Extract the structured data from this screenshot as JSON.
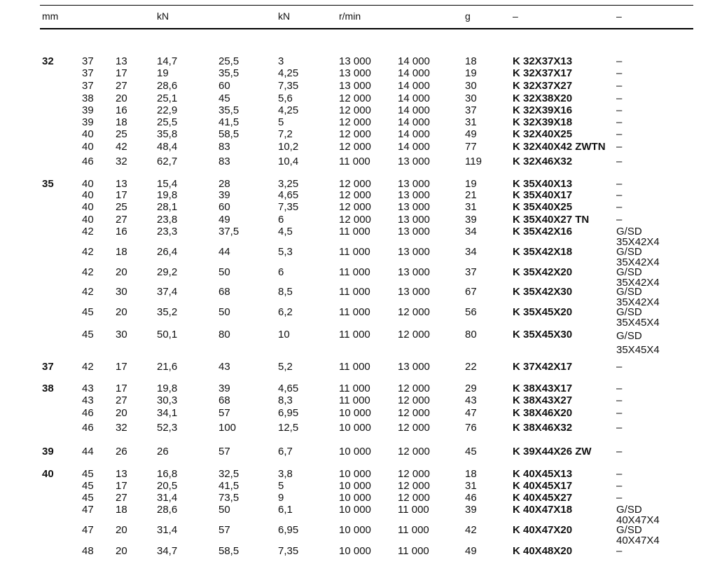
{
  "units": {
    "mm": "mm",
    "kn_1": "kN",
    "kn_2": "kN",
    "speed": "r/min",
    "mass": "g",
    "designation": "–",
    "accessory": "–"
  },
  "groups": [
    {
      "d": "32",
      "rows": [
        [
          "37",
          "13",
          "14,7",
          "25,5",
          "3",
          "13 000",
          "14 000",
          "18",
          "K 32X37X13",
          "–"
        ],
        [
          "37",
          "17",
          "19",
          "35,5",
          "4,25",
          "13 000",
          "14 000",
          "19",
          "K 32X37X17",
          "–"
        ],
        [
          "37",
          "27",
          "28,6",
          "60",
          "7,35",
          "13 000",
          "14 000",
          "30",
          "K 32X37X27",
          "–"
        ],
        [
          "38",
          "20",
          "25,1",
          "45",
          "5,6",
          "12 000",
          "14 000",
          "30",
          "K 32X38X20",
          "–"
        ],
        [
          "39",
          "16",
          "22,9",
          "35,5",
          "4,25",
          "12 000",
          "14 000",
          "37",
          "K 32X39X16",
          "–"
        ],
        [
          "39",
          "18",
          "25,5",
          "41,5",
          "5",
          "12 000",
          "14 000",
          "31",
          "K 32X39X18",
          "–"
        ],
        [
          "40",
          "25",
          "35,8",
          "58,5",
          "7,2",
          "12 000",
          "14 000",
          "49",
          "K 32X40X25",
          "–"
        ],
        [
          "40",
          "42",
          "48,4",
          "83",
          "10,2",
          "12 000",
          "14 000",
          "77",
          "K 32X40X42 ZWTN",
          "–"
        ],
        [
          "46",
          "32",
          "62,7",
          "83",
          "10,4",
          "11 000",
          "13 000",
          "119",
          "K 32X46X32",
          "–"
        ]
      ]
    },
    {
      "d": "35",
      "rows": [
        [
          "40",
          "13",
          "15,4",
          "28",
          "3,25",
          "12 000",
          "13 000",
          "19",
          "K 35X40X13",
          "–"
        ],
        [
          "40",
          "17",
          "19,8",
          "39",
          "4,65",
          "12 000",
          "13 000",
          "21",
          "K 35X40X17",
          "–"
        ],
        [
          "40",
          "25",
          "28,1",
          "60",
          "7,35",
          "12 000",
          "13 000",
          "31",
          "K 35X40X25",
          "–"
        ],
        [
          "40",
          "27",
          "23,8",
          "49",
          "6",
          "12 000",
          "13 000",
          "39",
          "K 35X40X27 TN",
          "–"
        ],
        [
          "42",
          "16",
          "23,3",
          "37,5",
          "4,5",
          "11 000",
          "13 000",
          "34",
          "K 35X42X16",
          "G/SD 35X42X4"
        ],
        [
          "42",
          "18",
          "26,4",
          "44",
          "5,3",
          "11 000",
          "13 000",
          "34",
          "K 35X42X18",
          "G/SD 35X42X4"
        ],
        [
          "42",
          "20",
          "29,2",
          "50",
          "6",
          "11 000",
          "13 000",
          "37",
          "K 35X42X20",
          "G/SD 35X42X4"
        ],
        [
          "42",
          "30",
          "37,4",
          "68",
          "8,5",
          "11 000",
          "13 000",
          "67",
          "K 35X42X30",
          "G/SD 35X42X4"
        ],
        [
          "45",
          "20",
          "35,2",
          "50",
          "6,2",
          "11 000",
          "12 000",
          "56",
          "K 35X45X20",
          "G/SD 35X45X4"
        ],
        [
          "45",
          "30",
          "50,1",
          "80",
          "10",
          "11 000",
          "12 000",
          "80",
          "K 35X45X30",
          "G/SD 35X45X4"
        ]
      ]
    },
    {
      "d": "37",
      "rows": [
        [
          "42",
          "17",
          "21,6",
          "43",
          "5,2",
          "11 000",
          "13 000",
          "22",
          "K 37X42X17",
          "–"
        ]
      ]
    },
    {
      "d": "38",
      "rows": [
        [
          "43",
          "17",
          "19,8",
          "39",
          "4,65",
          "11 000",
          "12 000",
          "29",
          "K 38X43X17",
          "–"
        ],
        [
          "43",
          "27",
          "30,3",
          "68",
          "8,3",
          "11 000",
          "12 000",
          "43",
          "K 38X43X27",
          "–"
        ],
        [
          "46",
          "20",
          "34,1",
          "57",
          "6,95",
          "10 000",
          "12 000",
          "47",
          "K 38X46X20",
          "–"
        ],
        [
          "46",
          "32",
          "52,3",
          "100",
          "12,5",
          "10 000",
          "12 000",
          "76",
          "K 38X46X32",
          "–"
        ]
      ]
    },
    {
      "d": "39",
      "rows": [
        [
          "44",
          "26",
          "26",
          "57",
          "6,7",
          "10 000",
          "12 000",
          "45",
          "K 39X44X26 ZW",
          "–"
        ]
      ]
    },
    {
      "d": "40",
      "rows": [
        [
          "45",
          "13",
          "16,8",
          "32,5",
          "3,8",
          "10 000",
          "12 000",
          "18",
          "K 40X45X13",
          "–"
        ],
        [
          "45",
          "17",
          "20,5",
          "41,5",
          "5",
          "10 000",
          "12 000",
          "31",
          "K 40X45X17",
          "–"
        ],
        [
          "45",
          "27",
          "31,4",
          "73,5",
          "9",
          "10 000",
          "12 000",
          "46",
          "K 40X45X27",
          "–"
        ],
        [
          "47",
          "18",
          "28,6",
          "50",
          "6,1",
          "10 000",
          "11 000",
          "39",
          "K 40X47X18",
          "G/SD 40X47X4"
        ],
        [
          "47",
          "20",
          "31,4",
          "57",
          "6,95",
          "10 000",
          "11 000",
          "42",
          "K 40X47X20",
          "G/SD 40X47X4"
        ],
        [
          "48",
          "20",
          "34,7",
          "58,5",
          "7,35",
          "10 000",
          "11 000",
          "49",
          "K 40X48X20",
          "–"
        ]
      ]
    }
  ]
}
